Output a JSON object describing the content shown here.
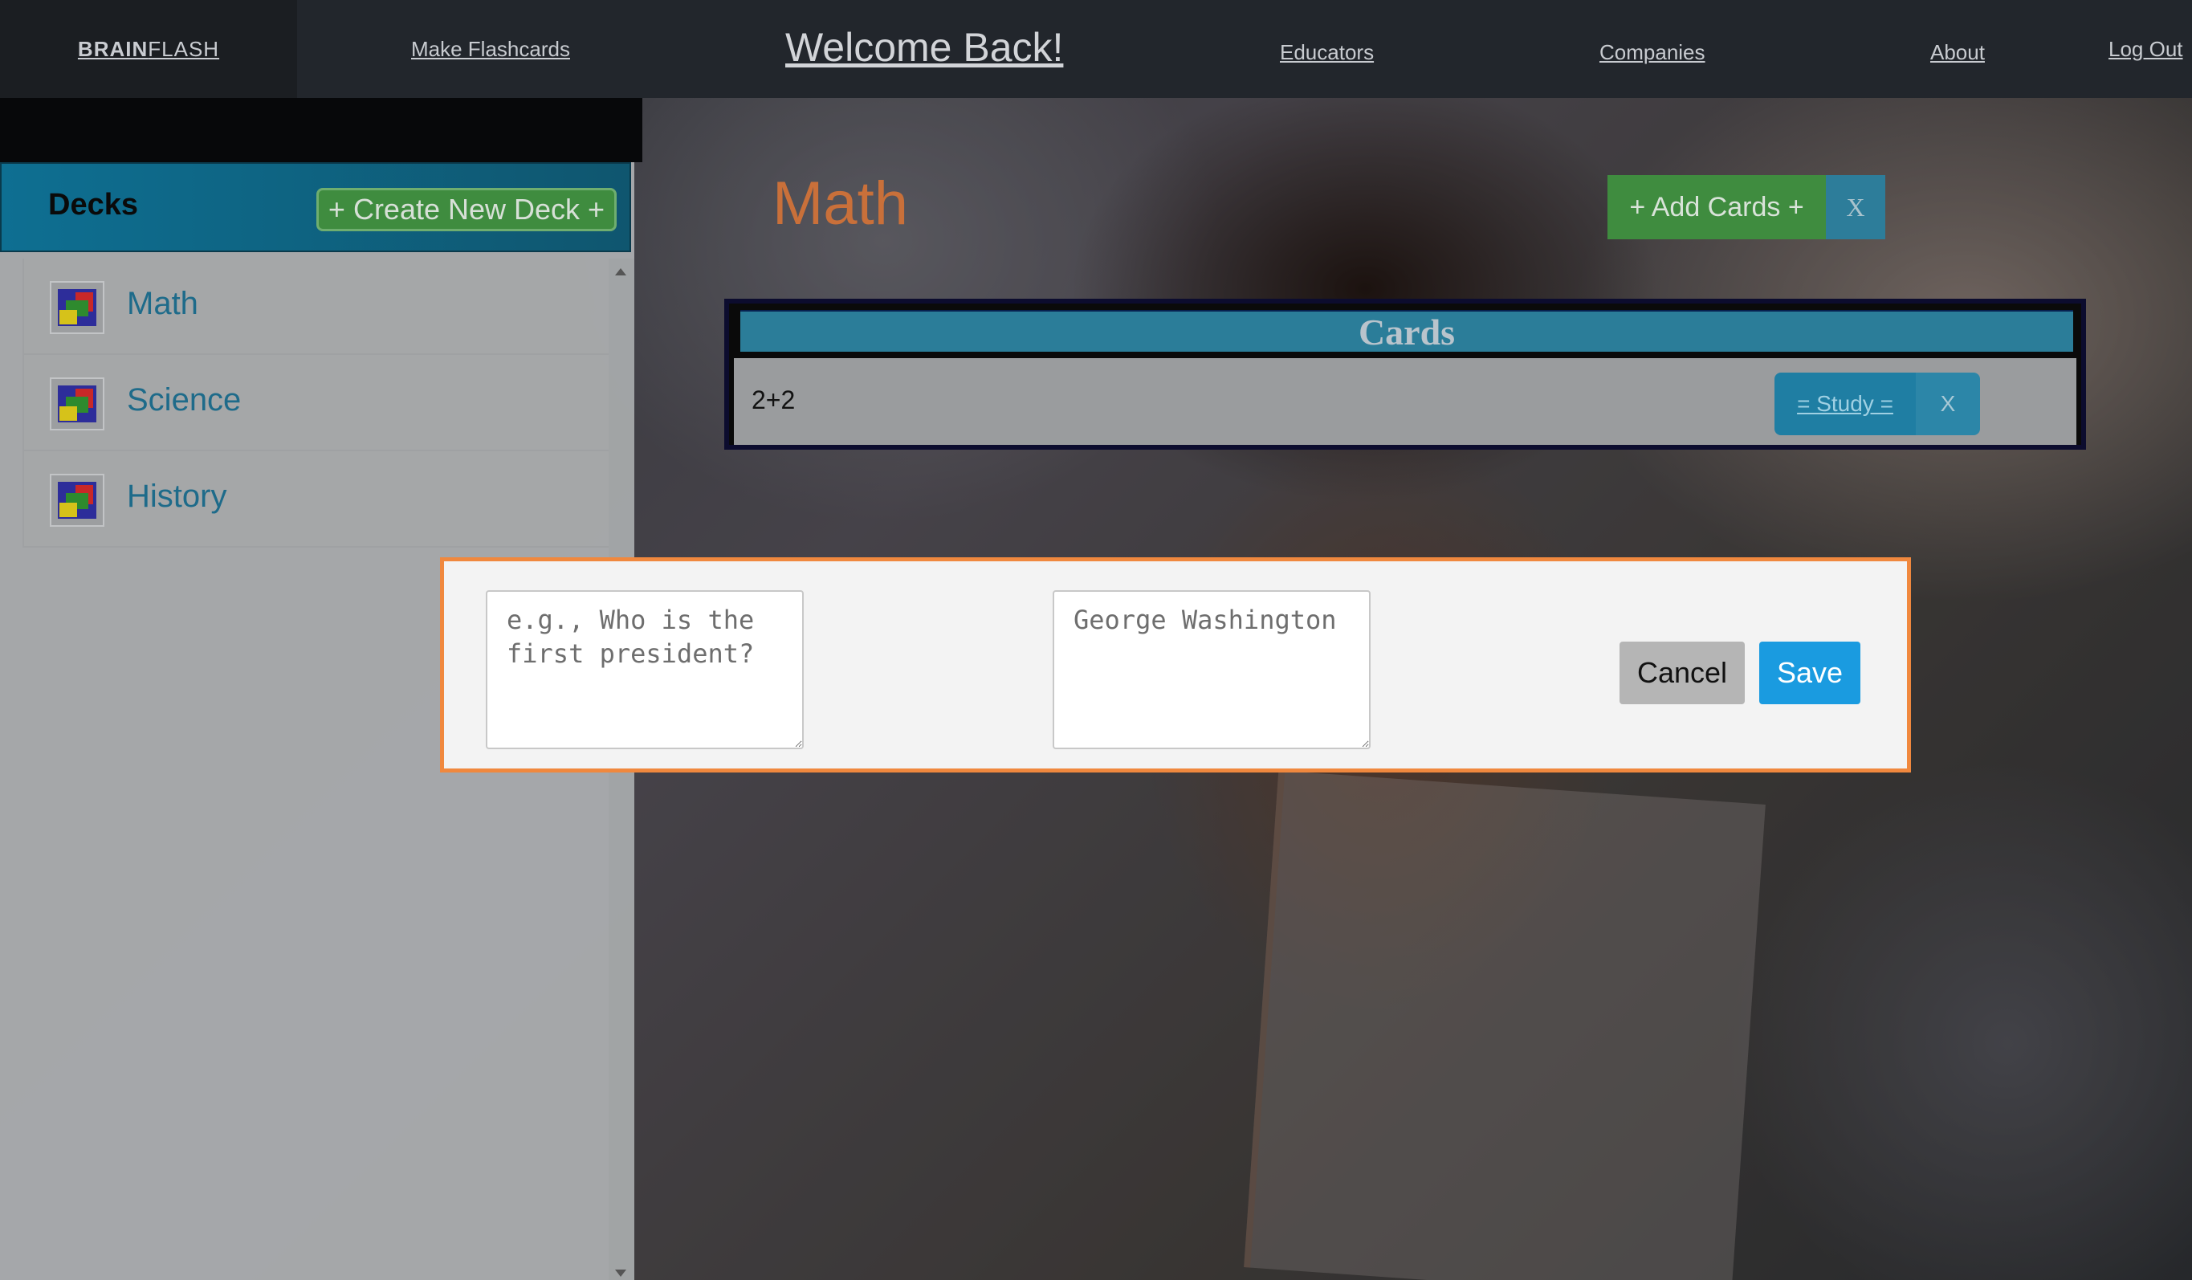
{
  "nav": {
    "brand_bold": "BRAIN",
    "brand_rest": "FLASH",
    "make_flashcards": "Make Flashcards",
    "welcome": "Welcome Back!",
    "educators": "Educators",
    "companies": "Companies",
    "about": "About",
    "logout": "Log Out"
  },
  "sidebar": {
    "title": "Decks",
    "create_label": "+ Create New Deck +",
    "decks": [
      {
        "label": "Math"
      },
      {
        "label": "Science"
      },
      {
        "label": "History"
      }
    ]
  },
  "deck": {
    "title": "Math",
    "add_cards_label": "+ Add Cards +",
    "close_label": "X",
    "cards_header": "Cards",
    "cards": [
      {
        "front": "2+2",
        "study_label": "= Study =",
        "delete_label": "X"
      }
    ]
  },
  "modal": {
    "question_placeholder": "e.g., Who is the first president?",
    "answer_placeholder": "George Washington",
    "cancel_label": "Cancel",
    "save_label": "Save"
  },
  "colors": {
    "accent_orange": "#f0883e",
    "save_blue": "#1a9be0",
    "add_green": "#3f8c3f",
    "header_teal": "#2b7d99"
  }
}
